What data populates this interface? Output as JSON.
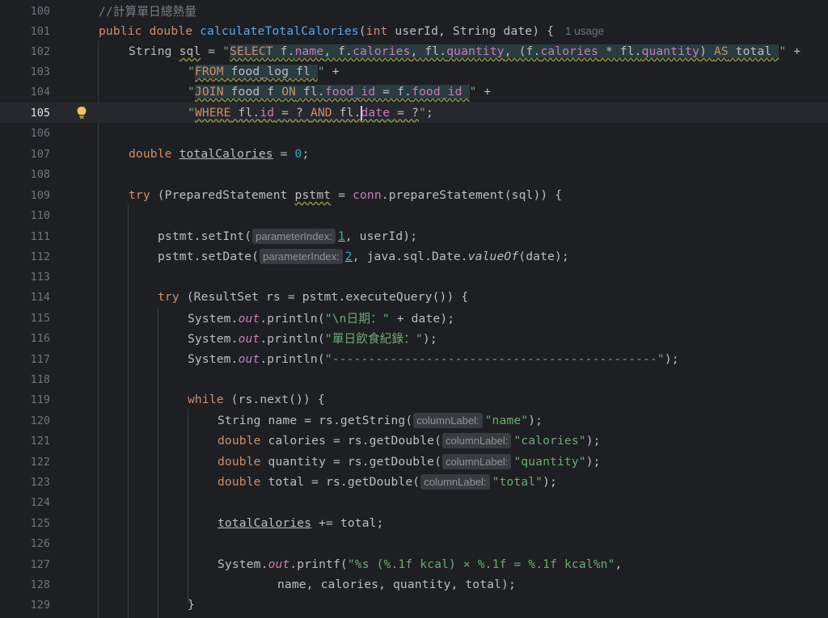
{
  "editor": {
    "current_line": "105",
    "usage_hint": "1 usage",
    "hint_parameterIndex": "parameterIndex:",
    "hint_columnLabel": "columnLabel:",
    "lines": {
      "l100": {
        "num": "100",
        "comment": "//計算單日總熱量"
      },
      "l101": {
        "num": "101",
        "kw_public": "public",
        "kw_double": "double",
        "fn": "calculateTotalCalories",
        "p1": "(",
        "kw_int": "int",
        "p2": " userId, String date) {"
      },
      "l102": {
        "num": "102",
        "a": "String ",
        "b": "sql",
        "c": " = ",
        "q1": "\"",
        "sel": "SELECT",
        "s1": " f.",
        "f_name": "name",
        "s2": ", f.",
        "f_cal": "calories",
        "s3": ", fl.",
        "f_qty": "quantity",
        "s4": ", (f.",
        "f_cal2": "calories",
        "s5": " * fl.",
        "f_qty2": "quantity",
        "s6": ") ",
        "as": "AS",
        "s7": " total ",
        "q2": "\"",
        "plus": " +"
      },
      "l103": {
        "num": "103",
        "q1": "\"",
        "from": "FROM",
        "s1": " food_log fl ",
        "q2": "\"",
        "plus": " +"
      },
      "l104": {
        "num": "104",
        "q1": "\"",
        "join": "JOIN",
        "s1": " food f ",
        "on": "ON",
        "s2": " fl.",
        "f1": "food_id",
        "s3": " = f.",
        "f2": "food_id",
        "s4": " ",
        "q2": "\"",
        "plus": " +"
      },
      "l105": {
        "num": "105",
        "q1": "\"",
        "where": "WHERE",
        "s1": " fl.",
        "f1": "id",
        "s2": " = ? ",
        "and": "AND",
        "s3": " fl.",
        "f2": "date",
        "s4": " = ?",
        "q2": "\"",
        "end": ";"
      },
      "l106": {
        "num": "106"
      },
      "l107": {
        "num": "107",
        "kw": "double",
        "var": "totalCalories",
        "eq": " = ",
        "n": "0",
        "end": ";"
      },
      "l108": {
        "num": "108"
      },
      "l109": {
        "num": "109",
        "kw": "try",
        "a": " (PreparedStatement ",
        "var": "pstmt",
        "b": " = ",
        "conn": "conn",
        "c": ".prepareStatement(sql)) {"
      },
      "l110": {
        "num": "110"
      },
      "l111": {
        "num": "111",
        "a": "pstmt.setInt(",
        "n": "1",
        "b": ", userId);"
      },
      "l112": {
        "num": "112",
        "a": "pstmt.setDate(",
        "n": "2",
        "b": ", java.sql.Date.",
        "m": "valueOf",
        "c": "(date);"
      },
      "l113": {
        "num": "113"
      },
      "l114": {
        "num": "114",
        "kw": "try",
        "a": " (ResultSet rs = pstmt.executeQuery()) {"
      },
      "l115": {
        "num": "115",
        "a": "System.",
        "out": "out",
        "b": ".println(",
        "str": "\"\\n日期：\"",
        "c": " + date);"
      },
      "l116": {
        "num": "116",
        "a": "System.",
        "out": "out",
        "b": ".println(",
        "str": "\"單日飲食紀錄：\"",
        "c": ");"
      },
      "l117": {
        "num": "117",
        "a": "System.",
        "out": "out",
        "b": ".println(",
        "str": "\"---------------------------------------------\"",
        "c": ");"
      },
      "l118": {
        "num": "118"
      },
      "l119": {
        "num": "119",
        "kw": "while",
        "a": " (rs.next()) {"
      },
      "l120": {
        "num": "120",
        "a": "String name = rs.getString(",
        "str": "\"name\"",
        "b": ");"
      },
      "l121": {
        "num": "121",
        "kw": "double",
        "a": " calories = rs.getDouble(",
        "str": "\"calories\"",
        "b": ");"
      },
      "l122": {
        "num": "122",
        "kw": "double",
        "a": " quantity = rs.getDouble(",
        "str": "\"quantity\"",
        "b": ");"
      },
      "l123": {
        "num": "123",
        "kw": "double",
        "a": " total = rs.getDouble(",
        "str": "\"total\"",
        "b": ");"
      },
      "l124": {
        "num": "124"
      },
      "l125": {
        "num": "125",
        "var": "totalCalories",
        "a": " += total;"
      },
      "l126": {
        "num": "126"
      },
      "l127": {
        "num": "127",
        "a": "System.",
        "out": "out",
        "b": ".printf(",
        "str": "\"%s (%.1f kcal) × %.1f = %.1f kcal%n\"",
        "c": ","
      },
      "l128": {
        "num": "128",
        "a": "name, calories, quantity, total);"
      },
      "l129": {
        "num": "129",
        "a": "}"
      }
    }
  },
  "colors": {
    "background": "#1e1f22",
    "keyword": "#cf8e6d",
    "function": "#56a8f5",
    "string": "#6aab73",
    "number": "#2aacb8",
    "field": "#c77dbb",
    "comment": "#7a7e85"
  },
  "icons": {
    "intention_bulb": "lightbulb-icon"
  }
}
